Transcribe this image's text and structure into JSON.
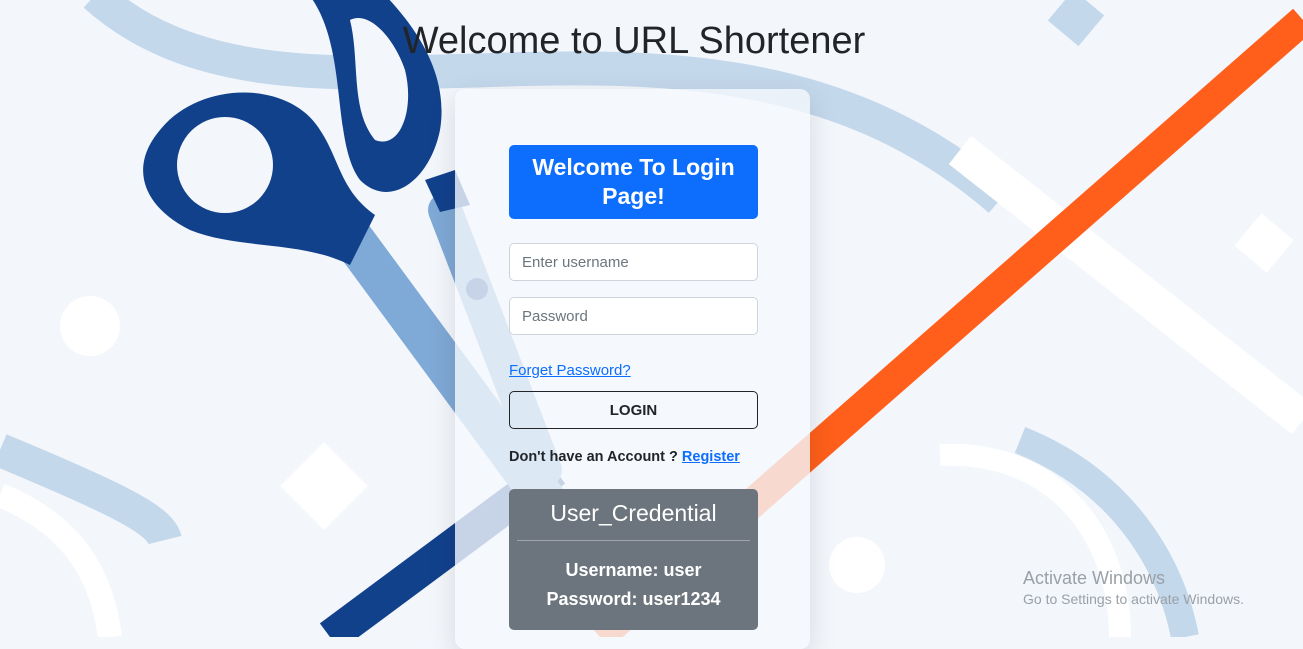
{
  "header": {
    "title": "Welcome to URL Shortener"
  },
  "login_card": {
    "banner": "Welcome To Login Page!",
    "username": {
      "placeholder": "Enter username",
      "value": ""
    },
    "password": {
      "placeholder": "Password",
      "value": ""
    },
    "forget_password": "Forget Password?",
    "login_button": "LOGIN",
    "no_account_text": "Don't have an Account ?",
    "register_link": "Register"
  },
  "credentials": {
    "title": "User_Credential",
    "username_line": "Username: user",
    "password_line": "Password: user1234"
  },
  "os_watermark": {
    "title": "Activate Windows",
    "subtitle": "Go to Settings to activate Windows."
  },
  "colors": {
    "primary": "#0d6efd",
    "secondary": "#6c757d",
    "scissors_dark": "#12418c",
    "scissors_light": "#7fa9d6",
    "orange_line": "#ff5f1a"
  }
}
